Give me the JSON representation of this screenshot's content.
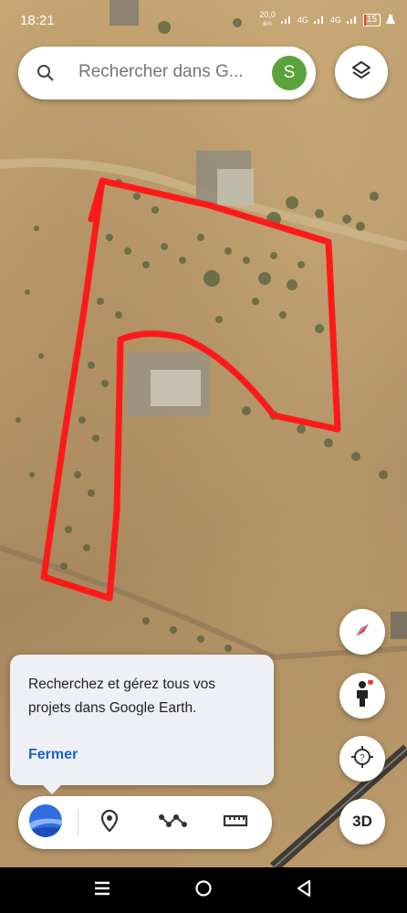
{
  "status_bar": {
    "time": "18:21",
    "network_speed": "20,0",
    "network_speed_unit": "B/S",
    "network_type_1": "4G",
    "network_type_2": "4G",
    "battery_level": "15"
  },
  "search": {
    "placeholder": "Rechercher dans G...",
    "avatar_letter": "S"
  },
  "controls": {
    "layers_icon": "layers-icon",
    "compass_icon": "compass-icon",
    "pegman_icon": "street-view-pegman-icon",
    "locate_icon": "my-location-icon",
    "three_d_label": "3D"
  },
  "tooltip": {
    "text": "Recherchez et gérez tous vos projets dans Google Earth.",
    "close_label": "Fermer"
  },
  "toolbar": {
    "items": [
      {
        "icon": "google-earth-logo-icon"
      },
      {
        "icon": "placemark-icon"
      },
      {
        "icon": "path-icon"
      },
      {
        "icon": "measure-ruler-icon"
      }
    ]
  },
  "nav": {
    "recent_icon": "recent-apps-icon",
    "home_icon": "home-icon",
    "back_icon": "back-icon"
  },
  "colors": {
    "polygon": "#ff1a1a",
    "avatar": "#5aa33b",
    "link": "#1b61c9"
  }
}
